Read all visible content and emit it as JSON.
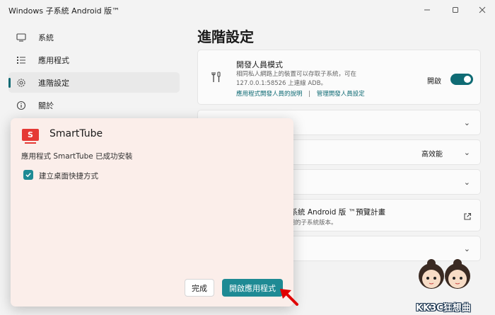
{
  "window": {
    "title": "Windows 子系統 Android 版™",
    "minimize_icon": "minimize-icon",
    "maximize_icon": "maximize-icon",
    "close_icon": "close-icon"
  },
  "sidebar": {
    "items": [
      {
        "label": "系統",
        "icon": "monitor-icon"
      },
      {
        "label": "應用程式",
        "icon": "list-icon"
      },
      {
        "label": "進階設定",
        "icon": "gear-icon",
        "active": true
      },
      {
        "label": "關於",
        "icon": "info-icon"
      }
    ]
  },
  "main": {
    "page_title": "進階設定",
    "developer": {
      "title": "開發人員模式",
      "desc_line1": "相同私人網路上的裝置可以存取子系統，可在",
      "desc_line2": "127.0.0.1:58526 上連線 ADB。",
      "link1": "應用程式開發人員的說明",
      "separator": "|",
      "link2": "管理開發人員設定",
      "toggle_label": "開啟",
      "toggle_on": true
    },
    "row3_value": "高效能",
    "preview_title_partial": "子系統 Android 版 ™預覽計畫",
    "preview_desc_partial": "早期的子系統版本。"
  },
  "dialog": {
    "app_name": "SmartTube",
    "app_icon_letter": "S",
    "message": "應用程式 SmartTube 已成功安裝",
    "checkbox_label": "建立桌面快捷方式",
    "checkbox_checked": true,
    "done_button": "完成",
    "open_button": "開啟應用程式"
  },
  "watermark": {
    "text": "KK3C狂想曲"
  },
  "colors": {
    "accent": "#0f6b74",
    "dialog_bg": "#fbeeea",
    "app_icon_red": "#e53935",
    "arrow_red": "#e00000"
  }
}
